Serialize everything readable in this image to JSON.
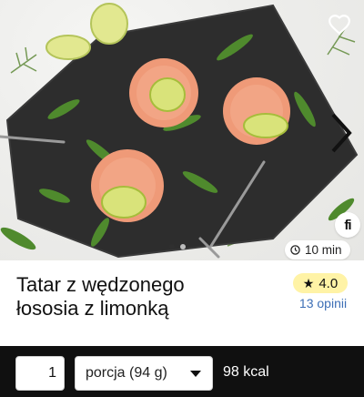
{
  "hero": {
    "time": "10 min",
    "brand_badge": "fi",
    "slides": 2,
    "active_slide": 1,
    "icons": {
      "favorite": "heart-outline-icon",
      "next": "chevron-right-icon",
      "time": "clock-icon"
    }
  },
  "recipe": {
    "title_line1": "Tatar z wędzonego",
    "title_line2": "łososia z limonką",
    "rating": "4.0",
    "reviews": "13 opinii"
  },
  "bottom_bar": {
    "quantity": "1",
    "portion": "porcja (94 g)",
    "kcal": "98 kcal"
  },
  "colors": {
    "rating_bg": "#fff3a6",
    "reviews_link": "#3d6fb6",
    "bottom_bar_bg": "#101010",
    "slate": "#2b2b2b"
  }
}
